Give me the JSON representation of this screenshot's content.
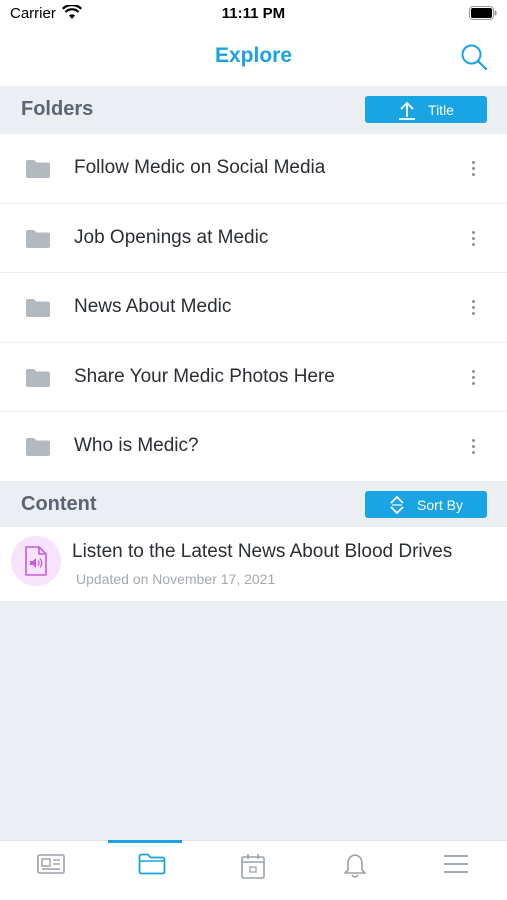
{
  "status_bar": {
    "carrier": "Carrier",
    "time": "11:11 PM"
  },
  "header": {
    "title": "Explore",
    "search_icon": "search-icon"
  },
  "folders_section": {
    "title": "Folders",
    "sort_label": "Title",
    "sort_icon": "upload-arrow-icon",
    "items": [
      {
        "label": "Follow Medic on Social Media",
        "icon": "folder-icon"
      },
      {
        "label": "Job Openings at Medic",
        "icon": "folder-icon"
      },
      {
        "label": "News About Medic",
        "icon": "folder-icon"
      },
      {
        "label": "Share Your Medic Photos Here",
        "icon": "folder-icon"
      },
      {
        "label": "Who is Medic?",
        "icon": "folder-icon"
      }
    ]
  },
  "content_section": {
    "title": "Content",
    "sort_label": "Sort By",
    "sort_icon": "up-down-chevron-icon",
    "items": [
      {
        "title": "Listen to the Latest News About Blood Drives",
        "updated": "Updated on November 17, 2021",
        "icon": "audio-file-icon"
      }
    ]
  },
  "tab_bar": {
    "tabs": [
      {
        "name": "newspaper-icon",
        "active": false
      },
      {
        "name": "folder-icon",
        "active": true
      },
      {
        "name": "calendar-icon",
        "active": false
      },
      {
        "name": "bell-icon",
        "active": false
      },
      {
        "name": "menu-icon",
        "active": false
      }
    ]
  },
  "colors": {
    "accent": "#1aa3e0",
    "background": "#ebeff4",
    "header_text": "#5c6373",
    "audio_icon": "#c75ce0"
  }
}
